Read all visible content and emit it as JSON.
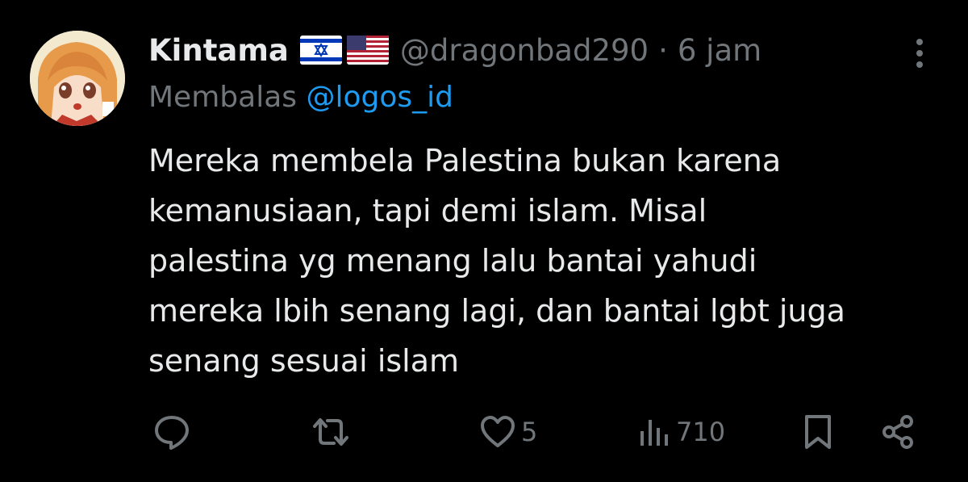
{
  "tweet": {
    "name": "Kintama",
    "handle": "@dragonbad290",
    "separator": "·",
    "time": "6 jam",
    "reply_prefix": "Membalas",
    "reply_mention": "@logos_id",
    "text": "Mereka membela Palestina bukan karena\nkemanusiaan, tapi demi islam. Misal\npalestina yg menang lalu bantai yahudi\nmereka lbih senang lagi, dan bantai lgbt juga\nsenang sesuai islam",
    "flags": [
      "israel-flag",
      "us-flag"
    ]
  },
  "actions": {
    "likes": "5",
    "views": "710"
  },
  "colors": {
    "background": "#000000",
    "text": "#e7e9ea",
    "muted": "#71767b",
    "mention": "#1d9bf0"
  }
}
